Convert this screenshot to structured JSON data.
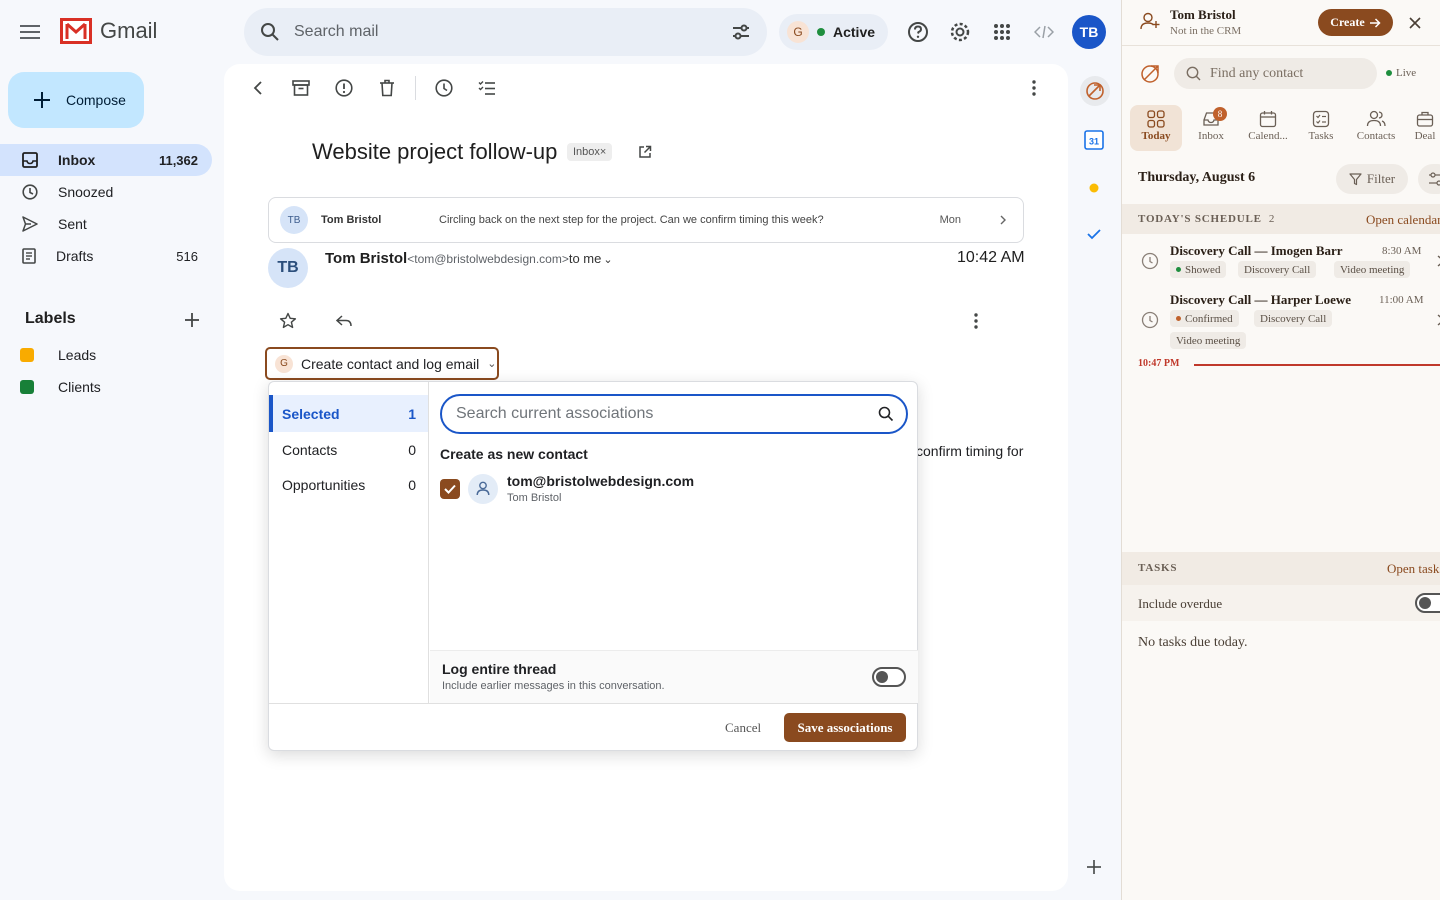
{
  "app": {
    "name": "Gmail"
  },
  "search": {
    "placeholder": "Search mail"
  },
  "status": {
    "badge": "G",
    "label": "Active"
  },
  "account": {
    "initials": "TB"
  },
  "compose": {
    "label": "Compose"
  },
  "nav": [
    {
      "label": "Inbox",
      "count": "11,362"
    },
    {
      "label": "Snoozed",
      "count": ""
    },
    {
      "label": "Sent",
      "count": ""
    },
    {
      "label": "Drafts",
      "count": "516"
    }
  ],
  "labels": {
    "title": "Labels",
    "items": [
      {
        "name": "Leads",
        "color": "#f9ab00"
      },
      {
        "name": "Clients",
        "color": "#188038"
      }
    ]
  },
  "thread": {
    "subject": "Website project follow-up",
    "chip": "Inbox×",
    "collapsed": {
      "initials": "TB",
      "sender": "Tom Bristol",
      "snippet": "Circling back on the next step for the project. Can we confirm timing this week?",
      "date": "Mon"
    },
    "message": {
      "initials": "TB",
      "sender": "Tom Bristol",
      "email": "<tom@bristolwebdesign.com>",
      "to": "to me",
      "time": "10:42 AM",
      "body_fragment": "confirm timing for"
    }
  },
  "crm_button": {
    "badge": "G",
    "label": "Create contact and log email"
  },
  "assoc": {
    "tabs": [
      {
        "label": "Selected",
        "count": "1"
      },
      {
        "label": "Contacts",
        "count": "0"
      },
      {
        "label": "Opportunities",
        "count": "0"
      }
    ],
    "search_placeholder": "Search current associations",
    "new_contact_heading": "Create as new contact",
    "candidate": {
      "email": "tom@bristolwebdesign.com",
      "name": "Tom Bristol",
      "checked": true
    },
    "log_thread": {
      "title": "Log entire thread",
      "desc": "Include earlier messages in this conversation.",
      "enabled": false
    },
    "cancel": "Cancel",
    "save": "Save associations"
  },
  "crm": {
    "contact_name": "Tom Bristol",
    "contact_status": "Not in the CRM",
    "create_label": "Create",
    "find_placeholder": "Find any contact",
    "live_label": "Live",
    "tabs": [
      {
        "label": "Today",
        "badge": ""
      },
      {
        "label": "Inbox",
        "badge": "8"
      },
      {
        "label": "Calend...",
        "badge": ""
      },
      {
        "label": "Tasks",
        "badge": ""
      },
      {
        "label": "Contacts",
        "badge": ""
      },
      {
        "label": "Deal",
        "badge": ""
      }
    ],
    "date": "Thursday, August 6",
    "filter_label": "Filter",
    "schedule": {
      "title": "TODAY'S SCHEDULE",
      "count": "2",
      "open_label": "Open calendar",
      "events": [
        {
          "name": "Discovery Call — Imogen Barr",
          "time": "8:30 AM",
          "status": "Showed",
          "status_color": "#1e8e3e",
          "tags": [
            "Discovery Call",
            "Video meeting"
          ]
        },
        {
          "name": "Discovery Call — Harper Loewe",
          "time": "11:00 AM",
          "status": "Confirmed",
          "status_color": "#c0612c",
          "tags": [
            "Discovery Call",
            "Video meeting"
          ]
        }
      ],
      "now_time": "10:47 PM"
    },
    "tasks": {
      "title": "TASKS",
      "open_label": "Open tasks",
      "overdue_label": "Include overdue",
      "overdue_enabled": false,
      "empty_text": "No tasks due today."
    }
  }
}
